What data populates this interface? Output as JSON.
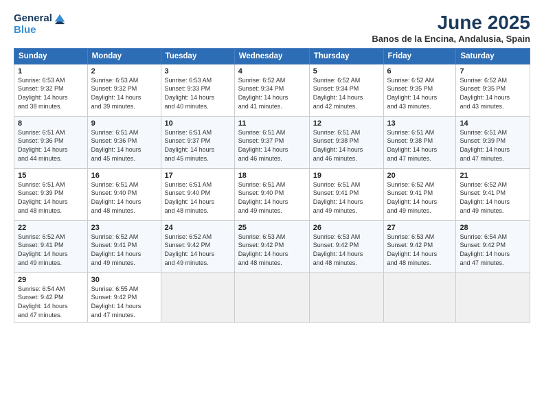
{
  "logo": {
    "line1": "General",
    "line2": "Blue"
  },
  "title": "June 2025",
  "subtitle": "Banos de la Encina, Andalusia, Spain",
  "days_header": [
    "Sunday",
    "Monday",
    "Tuesday",
    "Wednesday",
    "Thursday",
    "Friday",
    "Saturday"
  ],
  "weeks": [
    [
      {
        "day": "1",
        "info": "Sunrise: 6:53 AM\nSunset: 9:32 PM\nDaylight: 14 hours\nand 38 minutes."
      },
      {
        "day": "2",
        "info": "Sunrise: 6:53 AM\nSunset: 9:32 PM\nDaylight: 14 hours\nand 39 minutes."
      },
      {
        "day": "3",
        "info": "Sunrise: 6:53 AM\nSunset: 9:33 PM\nDaylight: 14 hours\nand 40 minutes."
      },
      {
        "day": "4",
        "info": "Sunrise: 6:52 AM\nSunset: 9:34 PM\nDaylight: 14 hours\nand 41 minutes."
      },
      {
        "day": "5",
        "info": "Sunrise: 6:52 AM\nSunset: 9:34 PM\nDaylight: 14 hours\nand 42 minutes."
      },
      {
        "day": "6",
        "info": "Sunrise: 6:52 AM\nSunset: 9:35 PM\nDaylight: 14 hours\nand 43 minutes."
      },
      {
        "day": "7",
        "info": "Sunrise: 6:52 AM\nSunset: 9:35 PM\nDaylight: 14 hours\nand 43 minutes."
      }
    ],
    [
      {
        "day": "8",
        "info": "Sunrise: 6:51 AM\nSunset: 9:36 PM\nDaylight: 14 hours\nand 44 minutes."
      },
      {
        "day": "9",
        "info": "Sunrise: 6:51 AM\nSunset: 9:36 PM\nDaylight: 14 hours\nand 45 minutes."
      },
      {
        "day": "10",
        "info": "Sunrise: 6:51 AM\nSunset: 9:37 PM\nDaylight: 14 hours\nand 45 minutes."
      },
      {
        "day": "11",
        "info": "Sunrise: 6:51 AM\nSunset: 9:37 PM\nDaylight: 14 hours\nand 46 minutes."
      },
      {
        "day": "12",
        "info": "Sunrise: 6:51 AM\nSunset: 9:38 PM\nDaylight: 14 hours\nand 46 minutes."
      },
      {
        "day": "13",
        "info": "Sunrise: 6:51 AM\nSunset: 9:38 PM\nDaylight: 14 hours\nand 47 minutes."
      },
      {
        "day": "14",
        "info": "Sunrise: 6:51 AM\nSunset: 9:39 PM\nDaylight: 14 hours\nand 47 minutes."
      }
    ],
    [
      {
        "day": "15",
        "info": "Sunrise: 6:51 AM\nSunset: 9:39 PM\nDaylight: 14 hours\nand 48 minutes."
      },
      {
        "day": "16",
        "info": "Sunrise: 6:51 AM\nSunset: 9:40 PM\nDaylight: 14 hours\nand 48 minutes."
      },
      {
        "day": "17",
        "info": "Sunrise: 6:51 AM\nSunset: 9:40 PM\nDaylight: 14 hours\nand 48 minutes."
      },
      {
        "day": "18",
        "info": "Sunrise: 6:51 AM\nSunset: 9:40 PM\nDaylight: 14 hours\nand 49 minutes."
      },
      {
        "day": "19",
        "info": "Sunrise: 6:51 AM\nSunset: 9:41 PM\nDaylight: 14 hours\nand 49 minutes."
      },
      {
        "day": "20",
        "info": "Sunrise: 6:52 AM\nSunset: 9:41 PM\nDaylight: 14 hours\nand 49 minutes."
      },
      {
        "day": "21",
        "info": "Sunrise: 6:52 AM\nSunset: 9:41 PM\nDaylight: 14 hours\nand 49 minutes."
      }
    ],
    [
      {
        "day": "22",
        "info": "Sunrise: 6:52 AM\nSunset: 9:41 PM\nDaylight: 14 hours\nand 49 minutes."
      },
      {
        "day": "23",
        "info": "Sunrise: 6:52 AM\nSunset: 9:41 PM\nDaylight: 14 hours\nand 49 minutes."
      },
      {
        "day": "24",
        "info": "Sunrise: 6:52 AM\nSunset: 9:42 PM\nDaylight: 14 hours\nand 49 minutes."
      },
      {
        "day": "25",
        "info": "Sunrise: 6:53 AM\nSunset: 9:42 PM\nDaylight: 14 hours\nand 48 minutes."
      },
      {
        "day": "26",
        "info": "Sunrise: 6:53 AM\nSunset: 9:42 PM\nDaylight: 14 hours\nand 48 minutes."
      },
      {
        "day": "27",
        "info": "Sunrise: 6:53 AM\nSunset: 9:42 PM\nDaylight: 14 hours\nand 48 minutes."
      },
      {
        "day": "28",
        "info": "Sunrise: 6:54 AM\nSunset: 9:42 PM\nDaylight: 14 hours\nand 47 minutes."
      }
    ],
    [
      {
        "day": "29",
        "info": "Sunrise: 6:54 AM\nSunset: 9:42 PM\nDaylight: 14 hours\nand 47 minutes."
      },
      {
        "day": "30",
        "info": "Sunrise: 6:55 AM\nSunset: 9:42 PM\nDaylight: 14 hours\nand 47 minutes."
      },
      null,
      null,
      null,
      null,
      null
    ]
  ]
}
